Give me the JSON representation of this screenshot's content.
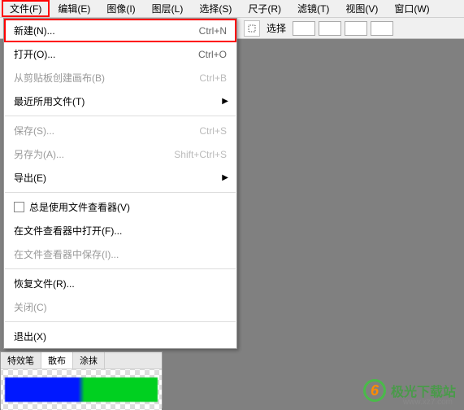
{
  "menubar": {
    "items": [
      {
        "label": "文件(F)"
      },
      {
        "label": "编辑(E)"
      },
      {
        "label": "图像(I)"
      },
      {
        "label": "图层(L)"
      },
      {
        "label": "选择(S)"
      },
      {
        "label": "尺子(R)"
      },
      {
        "label": "滤镜(T)"
      },
      {
        "label": "视图(V)"
      },
      {
        "label": "窗口(W)"
      }
    ]
  },
  "toolbar": {
    "select_label": "选择"
  },
  "file_menu": {
    "items": [
      {
        "label": "新建(N)...",
        "shortcut": "Ctrl+N",
        "enabled": true,
        "highlighted": true
      },
      {
        "label": "打开(O)...",
        "shortcut": "Ctrl+O",
        "enabled": true
      },
      {
        "label": "从剪贴板创建画布(B)",
        "shortcut": "Ctrl+B",
        "enabled": false
      },
      {
        "label": "最近所用文件(T)",
        "submenu": true,
        "enabled": true
      },
      {
        "separator": true
      },
      {
        "label": "保存(S)...",
        "shortcut": "Ctrl+S",
        "enabled": false
      },
      {
        "label": "另存为(A)...",
        "shortcut": "Shift+Ctrl+S",
        "enabled": false
      },
      {
        "label": "导出(E)",
        "submenu": true,
        "enabled": true
      },
      {
        "separator": true
      },
      {
        "label": "总是使用文件查看器(V)",
        "checkbox": true,
        "enabled": true
      },
      {
        "label": "在文件查看器中打开(F)...",
        "enabled": true
      },
      {
        "label": "在文件查看器中保存(I)...",
        "enabled": false
      },
      {
        "separator": true
      },
      {
        "label": "恢复文件(R)...",
        "enabled": true
      },
      {
        "label": "关闭(C)",
        "enabled": false
      },
      {
        "separator": true
      },
      {
        "label": "退出(X)",
        "enabled": true
      }
    ]
  },
  "bottom_tabs": {
    "items": [
      {
        "label": "特效笔"
      },
      {
        "label": "散布"
      },
      {
        "label": "涂抹"
      }
    ]
  },
  "watermark": {
    "text": "极光下载站",
    "logo_char": "6",
    "url": "www.xz7.com"
  }
}
